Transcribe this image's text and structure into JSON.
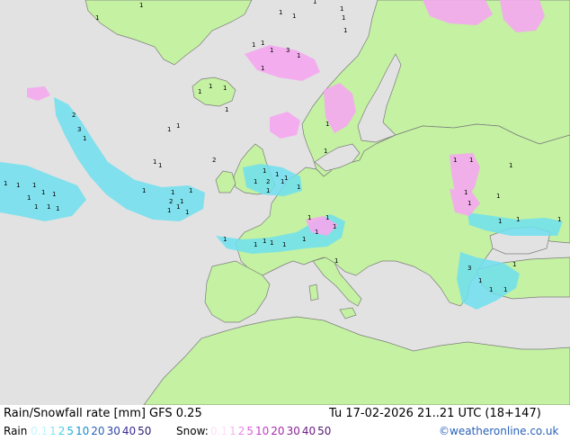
{
  "header": {
    "title": "Rain/Snowfall rate [mm] GFS 0.25",
    "datetime": "Tu 17-02-2026 21..21 UTC (18+147)"
  },
  "legend": {
    "rain_label": "Rain",
    "rain_values": [
      "0.1",
      "1",
      "2",
      "5",
      "10",
      "20",
      "30",
      "40",
      "50"
    ],
    "rain_colors": [
      "#bff5ff",
      "#7fe6f2",
      "#48d2e6",
      "#22b4d8",
      "#1c8cc8",
      "#2a62b8",
      "#2d42a6",
      "#3a2a94",
      "#2b1f6e"
    ],
    "snow_label": "Snow:",
    "snow_values": [
      "0.1",
      "1",
      "2",
      "5",
      "10",
      "20",
      "30",
      "40",
      "50"
    ],
    "snow_colors": [
      "#fde0f8",
      "#f7b6f2",
      "#ee88ea",
      "#e05ee0",
      "#c83cc8",
      "#a52aa8",
      "#8a2296",
      "#6e1e88",
      "#541a72"
    ],
    "credit": "©weatheronline.co.uk"
  },
  "map": {
    "sea_color": "#e2e2e2",
    "land_color": "#c4f1a2",
    "rain_color": "#6fe0f0",
    "snow_color": "#f5a8f0",
    "precip_labels": [
      "1",
      "1",
      "1",
      "1",
      "1",
      "1",
      "1",
      "1",
      "1",
      "3",
      "1",
      "1",
      "1",
      "1",
      "1",
      "1",
      "1",
      "1",
      "2",
      "3",
      "1",
      "1",
      "1",
      "1",
      "1",
      "2",
      "1",
      "1",
      "1",
      "1",
      "1",
      "1",
      "1",
      "1",
      "1",
      "1",
      "1",
      "1",
      "1",
      "1",
      "2",
      "1",
      "1",
      "1",
      "1",
      "1",
      "1",
      "2",
      "1",
      "1",
      "1",
      "1",
      "1",
      "1",
      "1",
      "1",
      "1",
      "1",
      "1",
      "1",
      "1",
      "1",
      "1",
      "1",
      "1",
      "1",
      "1",
      "1",
      "1",
      "1",
      "1",
      "1",
      "3",
      "1",
      "1",
      "1",
      "1",
      "1"
    ]
  }
}
